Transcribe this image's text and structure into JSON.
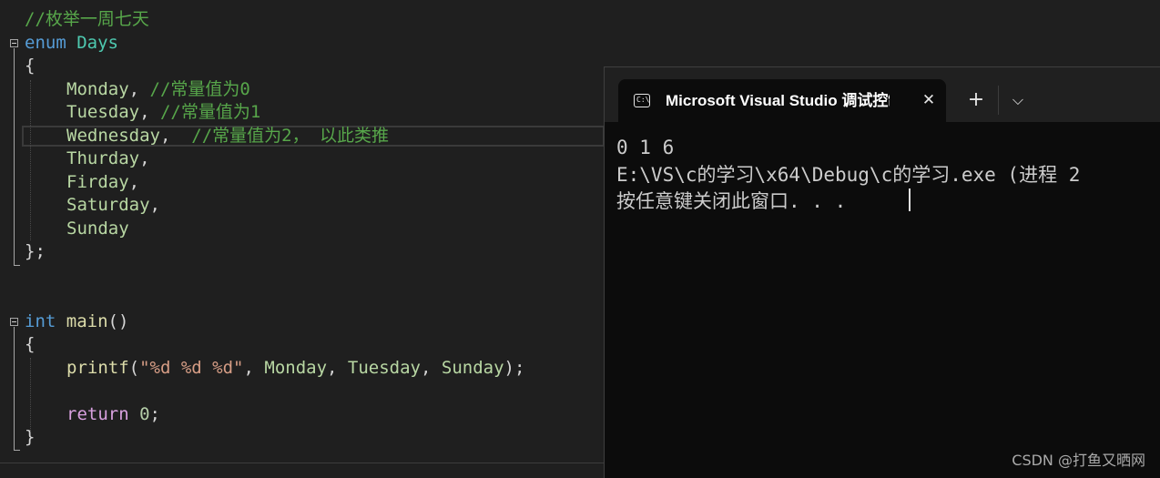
{
  "editor": {
    "lines": {
      "comment_enum": "//枚举一周七天",
      "enum_kw": "enum",
      "enum_name": "Days",
      "brace_open": "{",
      "monday": "Monday",
      "monday_comment": "//常量值为0",
      "tuesday": "Tuesday",
      "tuesday_comment": "//常量值为1",
      "wednesday": "Wednesday",
      "wednesday_comment": "//常量值为2， 以此类推",
      "thurday": "Thurday",
      "firday": "Firday",
      "saturday": "Saturday",
      "sunday": "Sunday",
      "enum_close": "};",
      "int_kw": "int",
      "main_fn": "main",
      "main_parens": "()",
      "main_brace_open": "{",
      "printf_fn": "printf",
      "printf_open": "(",
      "printf_format": "\"%d %d %d\"",
      "printf_args_monday": "Monday",
      "printf_args_tuesday": "Tuesday",
      "printf_args_sunday": "Sunday",
      "printf_close": ");",
      "return_kw": "return",
      "return_value": "0",
      "semicolon": ";",
      "main_brace_close": "}",
      "comma": ",",
      "comma_space": ", ",
      "comma_wed": ",  "
    }
  },
  "console": {
    "tab_title": "Microsoft Visual Studio 调试控制台",
    "tab_icon_text": "C:\\",
    "close_glyph": "✕",
    "new_tab_glyph": "+",
    "dropdown_glyph": "⌵",
    "output": [
      "0 1 6",
      "E:\\VS\\c的学习\\x64\\Debug\\c的学习.exe (进程 2",
      "按任意键关闭此窗口. . ."
    ]
  },
  "watermark": "CSDN @打鱼又晒网",
  "colors": {
    "background": "#1f1f1f",
    "console_bg": "#0c0c0c",
    "comment": "#57a64a",
    "keyword": "#569cd6",
    "enum_member": "#b8d7a3"
  }
}
